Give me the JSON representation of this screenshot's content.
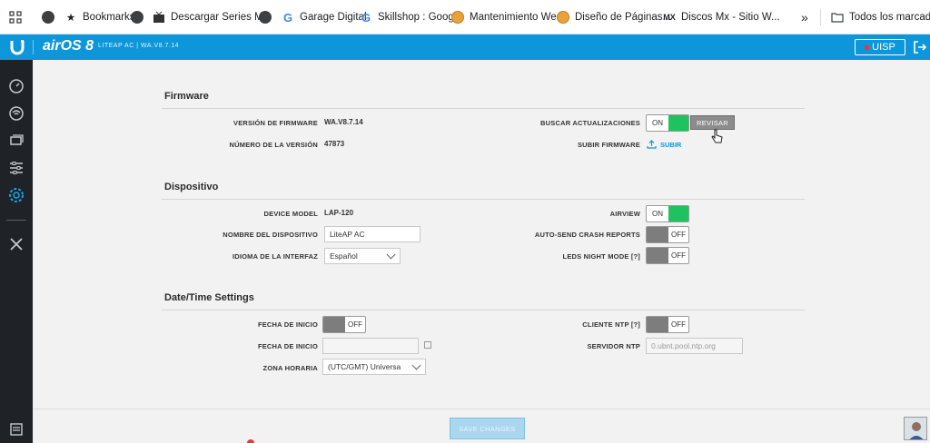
{
  "bookmarks_bar": {
    "items": [
      {
        "icon": "apps-grid-icon",
        "label": ""
      },
      {
        "icon": "globe-icon",
        "label": ""
      },
      {
        "icon": "star-icon",
        "label": "Bookmarks"
      },
      {
        "icon": "globe-icon",
        "label": ""
      },
      {
        "icon": "series-icon",
        "label": "Descargar Series M..."
      },
      {
        "icon": "globe-icon",
        "label": ""
      },
      {
        "icon": "google-icon",
        "label": "Garage Digital"
      },
      {
        "icon": "google-icon",
        "label": "Skillshop : Google"
      },
      {
        "icon": "wordpress-icon",
        "label": "Mantenimiento We..."
      },
      {
        "icon": "wordpress-icon",
        "label": "Diseño de Páginas..."
      },
      {
        "icon": "discos-icon",
        "label": "Discos Mx - Sitio W..."
      }
    ],
    "more": "»",
    "all_bookmarks": "Todos los marcadores"
  },
  "header": {
    "brand": "airOS 8",
    "device_version": "LITEAP AC | WA.V8.7.14",
    "uisp_label": "UISP",
    "accent_color": "#0d96d9"
  },
  "sidebar": {
    "items": [
      "dashboard-icon",
      "wireless-icon",
      "network-icon",
      "services-icon",
      "settings-icon",
      "tools-icon",
      "log-icon"
    ]
  },
  "firmware": {
    "title": "Firmware",
    "version_label": "VERSIÓN DE FIRMWARE",
    "version_value": "WA.V8.7.14",
    "build_label": "NÚMERO DE LA VERSIÓN",
    "build_value": "47873",
    "check_label": "BUSCAR ACTUALIZACIONES",
    "check_toggle": "ON",
    "revisar_button": "REVISAR",
    "upload_label": "SUBIR FIRMWARE",
    "upload_link": "SUBIR"
  },
  "device": {
    "title": "Dispositivo",
    "model_label": "DEVICE MODEL",
    "model_value": "LAP-120",
    "name_label": "NOMBRE DEL DISPOSITIVO",
    "name_value": "LiteAP AC",
    "language_label": "IDIOMA DE LA INTERFAZ",
    "language_value": "Español",
    "airview_label": "AIRVIEW",
    "airview_toggle": "ON",
    "crash_label": "AUTO-SEND CRASH REPORTS",
    "crash_toggle": "OFF",
    "leds_label": "LEDS NIGHT MODE [?]",
    "leds_toggle": "OFF"
  },
  "datetime": {
    "title": "Date/Time Settings",
    "start_label": "FECHA DE INICIO",
    "start_toggle": "OFF",
    "start_date_label": "FECHA DE INICIO",
    "start_date_value": "",
    "timezone_label": "ZONA HORARIA",
    "timezone_value": "(UTC/GMT) Universa",
    "ntp_label": "CLIENTE NTP [?]",
    "ntp_toggle": "OFF",
    "ntp_server_label": "SERVIDOR NTP",
    "ntp_server_placeholder": "0.ubnt.pool.ntp.org"
  },
  "footer": {
    "save_button": "SAVE CHANGES"
  }
}
